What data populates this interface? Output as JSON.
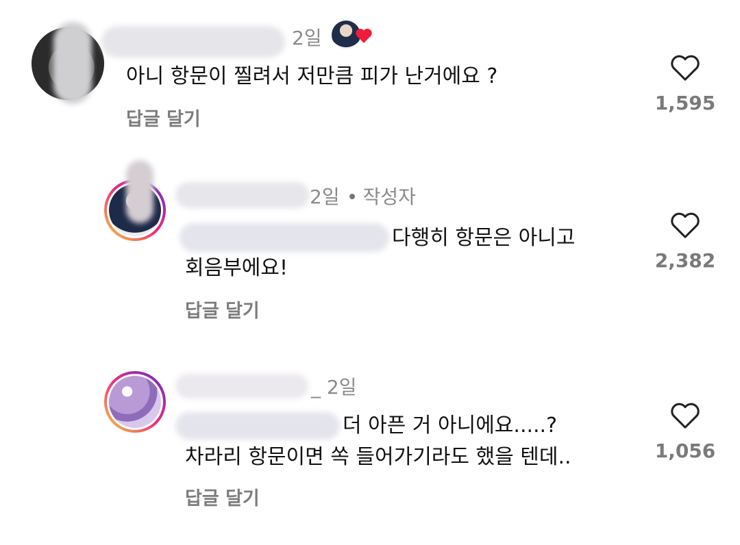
{
  "comments": [
    {
      "time": "2일",
      "text": "아니 항문이 찔려서 저만큼 피가 난거에요 ?",
      "reply_label": "답글 달기",
      "likes": "1,595",
      "like_icon": "heart-outline-icon",
      "badge_icon": "heart-filled-icon"
    },
    {
      "time": "2일",
      "author_tag": "작성자",
      "text_line1": "다행히 항문은 아니고",
      "text_line2": "회음부에요!",
      "reply_label": "답글 달기",
      "likes": "2,382",
      "like_icon": "heart-outline-icon"
    },
    {
      "time": "2일",
      "text_line1": "더 아픈 거 아니에요.....?",
      "text_line2": "차라리 항문이면 쏙 들어가기라도 했을 텐데..",
      "reply_label": "답글 달기",
      "likes": "1,056",
      "like_icon": "heart-outline-icon"
    }
  ],
  "colors": {
    "heart_red": "#ee1d3c",
    "story_ring": [
      "#f9ce34",
      "#ee2a7b",
      "#6228d7"
    ]
  }
}
